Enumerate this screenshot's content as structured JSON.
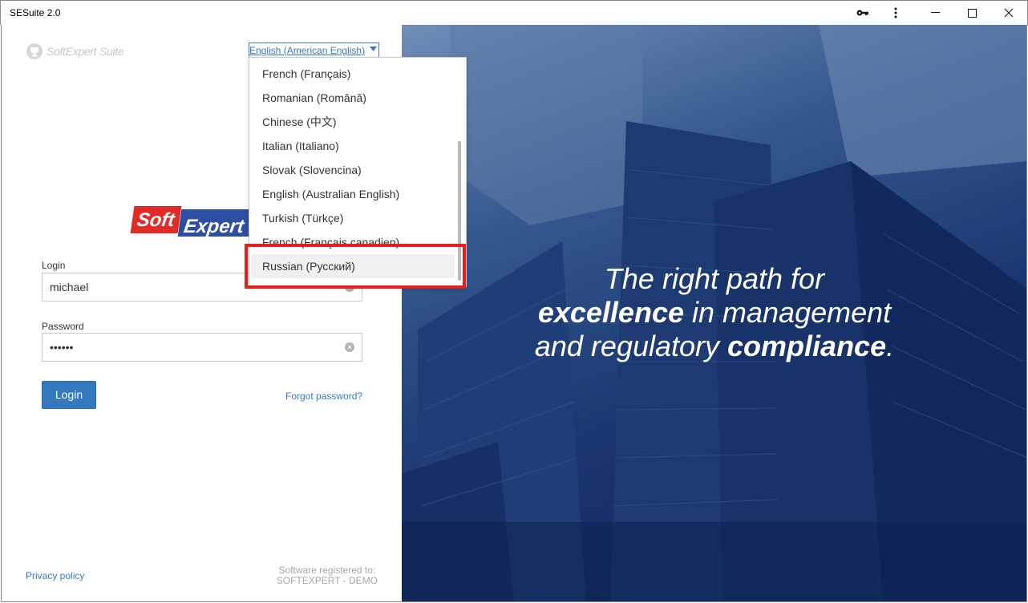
{
  "window": {
    "title": "SESuite 2.0"
  },
  "branding": {
    "small_logo_text": "SoftExpert Suite",
    "brand_soft": "Soft",
    "brand_expert": "Expert"
  },
  "language": {
    "selected": "English (American English)",
    "options": [
      {
        "label": "French (Français)"
      },
      {
        "label": "Romanian (Română)"
      },
      {
        "label": "Chinese (中文)"
      },
      {
        "label": "Italian (Italiano)"
      },
      {
        "label": "Slovak (Slovencina)"
      },
      {
        "label": "English (Australian English)"
      },
      {
        "label": "Turkish (Türkçe)"
      },
      {
        "label": "French (Français canadien)"
      },
      {
        "label": "Russian (Русский)"
      }
    ],
    "highlighted_index": 8
  },
  "form": {
    "login_label": "Login",
    "login_value": "michael",
    "password_label": "Password",
    "password_value": "••••••",
    "login_button": "Login",
    "forgot_link": "Forgot password?"
  },
  "footer": {
    "privacy_link": "Privacy policy",
    "registered_line1": "Software registered to:",
    "registered_line2": "SOFTEXPERT - DEMO"
  },
  "hero": {
    "line1": "The right path for",
    "line2_bold": "excellence",
    "line2_rest": " in management",
    "line3_start": "and regulatory ",
    "line3_bold": "compliance",
    "line3_end": "."
  },
  "colors": {
    "accent": "#3479bd",
    "link": "#3a78c5",
    "highlight_box": "#e0201d"
  }
}
